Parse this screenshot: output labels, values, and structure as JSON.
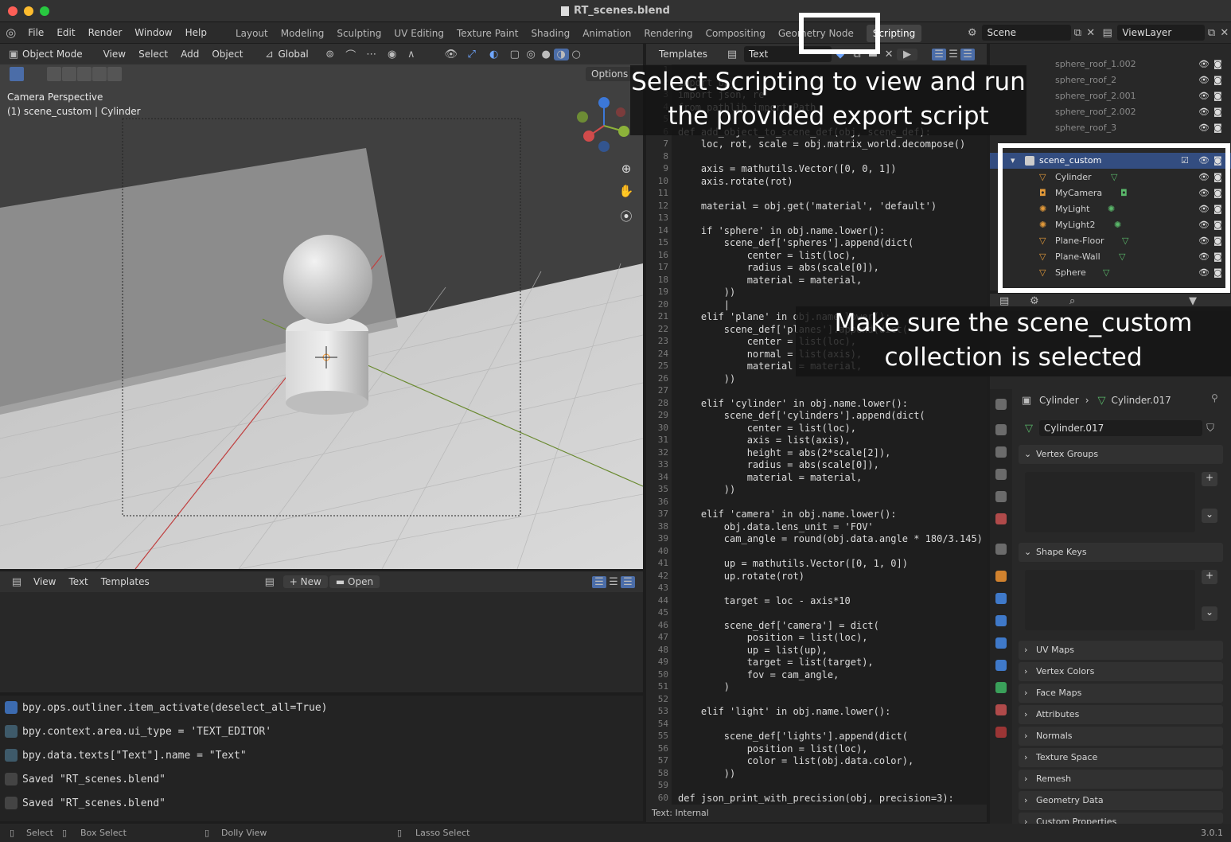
{
  "window": {
    "title": "RT_scenes.blend"
  },
  "menu": [
    "File",
    "Edit",
    "Render",
    "Window",
    "Help"
  ],
  "workspaces": [
    "Layout",
    "Modeling",
    "Sculpting",
    "UV Editing",
    "Texture Paint",
    "Shading",
    "Animation",
    "Rendering",
    "Compositing",
    "Geometry Node",
    "Scripting"
  ],
  "scene_field": "Scene",
  "viewlayer_field": "ViewLayer",
  "viewport": {
    "mode": "Object Mode",
    "menus": [
      "View",
      "Select",
      "Add",
      "Object"
    ],
    "transform": "Global",
    "options": "Options",
    "camera_label": "Camera Perspective",
    "object_label": "(1) scene_custom | Cylinder"
  },
  "text_editor": {
    "header_templates": "Templates",
    "text_name": "Text",
    "status": "Text: Internal",
    "lines": [
      {
        "n": "1",
        "t": ""
      },
      {
        "n": "2",
        "t": "import bpy"
      },
      {
        "n": "3",
        "t": "import json, re"
      },
      {
        "n": "4",
        "t": "from pathlib import Path"
      },
      {
        "n": "5",
        "t": ""
      },
      {
        "n": "6",
        "t": "def add_object_to_scene_def(obj, scene_def):"
      },
      {
        "n": "7",
        "t": "    loc, rot, scale = obj.matrix_world.decompose()"
      },
      {
        "n": "8",
        "t": ""
      },
      {
        "n": "9",
        "t": "    axis = mathutils.Vector([0, 0, 1])"
      },
      {
        "n": "10",
        "t": "    axis.rotate(rot)"
      },
      {
        "n": "11",
        "t": ""
      },
      {
        "n": "12",
        "t": "    material = obj.get('material', 'default')"
      },
      {
        "n": "13",
        "t": ""
      },
      {
        "n": "14",
        "t": "    if 'sphere' in obj.name.lower():"
      },
      {
        "n": "15",
        "t": "        scene_def['spheres'].append(dict("
      },
      {
        "n": "16",
        "t": "            center = list(loc),"
      },
      {
        "n": "17",
        "t": "            radius = abs(scale[0]),"
      },
      {
        "n": "18",
        "t": "            material = material,"
      },
      {
        "n": "19",
        "t": "        ))"
      },
      {
        "n": "20",
        "t": "        |"
      },
      {
        "n": "21",
        "t": "    elif 'plane' in obj.name.lower():"
      },
      {
        "n": "22",
        "t": "        scene_def['planes'].append(dict("
      },
      {
        "n": "23",
        "t": "            center = list(loc),"
      },
      {
        "n": "24",
        "t": "            normal = list(axis),"
      },
      {
        "n": "25",
        "t": "            material = material,"
      },
      {
        "n": "26",
        "t": "        ))"
      },
      {
        "n": "27",
        "t": ""
      },
      {
        "n": "28",
        "t": "    elif 'cylinder' in obj.name.lower():"
      },
      {
        "n": "29",
        "t": "        scene_def['cylinders'].append(dict("
      },
      {
        "n": "30",
        "t": "            center = list(loc),"
      },
      {
        "n": "31",
        "t": "            axis = list(axis),"
      },
      {
        "n": "32",
        "t": "            height = abs(2*scale[2]),"
      },
      {
        "n": "33",
        "t": "            radius = abs(scale[0]),"
      },
      {
        "n": "34",
        "t": "            material = material,"
      },
      {
        "n": "35",
        "t": "        ))"
      },
      {
        "n": "36",
        "t": ""
      },
      {
        "n": "37",
        "t": "    elif 'camera' in obj.name.lower():"
      },
      {
        "n": "38",
        "t": "        obj.data.lens_unit = 'FOV'"
      },
      {
        "n": "39",
        "t": "        cam_angle = round(obj.data.angle * 180/3.145)"
      },
      {
        "n": "40",
        "t": ""
      },
      {
        "n": "41",
        "t": "        up = mathutils.Vector([0, 1, 0])"
      },
      {
        "n": "42",
        "t": "        up.rotate(rot)"
      },
      {
        "n": "43",
        "t": ""
      },
      {
        "n": "44",
        "t": "        target = loc - axis*10"
      },
      {
        "n": "45",
        "t": ""
      },
      {
        "n": "46",
        "t": "        scene_def['camera'] = dict("
      },
      {
        "n": "47",
        "t": "            position = list(loc),"
      },
      {
        "n": "48",
        "t": "            up = list(up),"
      },
      {
        "n": "49",
        "t": "            target = list(target),"
      },
      {
        "n": "50",
        "t": "            fov = cam_angle,"
      },
      {
        "n": "51",
        "t": "        )"
      },
      {
        "n": "52",
        "t": ""
      },
      {
        "n": "53",
        "t": "    elif 'light' in obj.name.lower():"
      },
      {
        "n": "54",
        "t": ""
      },
      {
        "n": "55",
        "t": "        scene_def['lights'].append(dict("
      },
      {
        "n": "56",
        "t": "            position = list(loc),"
      },
      {
        "n": "57",
        "t": "            color = list(obj.data.color),"
      },
      {
        "n": "58",
        "t": "        ))"
      },
      {
        "n": "59",
        "t": ""
      },
      {
        "n": "60",
        "t": "def json_print_with_precision(obj, precision=3):"
      }
    ]
  },
  "outliner": {
    "top_items": [
      "sphere_roof_1.002",
      "sphere_roof_2",
      "sphere_roof_2.001",
      "sphere_roof_2.002",
      "sphere_roof_3"
    ],
    "collection": "scene_custom",
    "items": [
      "Cylinder",
      "MyCamera",
      "MyLight",
      "MyLight2",
      "Plane-Floor",
      "Plane-Wall",
      "Sphere"
    ]
  },
  "lower_editor": {
    "menus": [
      "View",
      "Text",
      "Templates"
    ],
    "new": "New",
    "open": "Open"
  },
  "info_log": [
    "bpy.ops.outliner.item_activate(deselect_all=True)",
    "bpy.context.area.ui_type = 'TEXT_EDITOR'",
    "bpy.data.texts[\"Text\"].name = \"Text\"",
    "Saved \"RT_scenes.blend\"",
    "Saved \"RT_scenes.blend\""
  ],
  "properties": {
    "breadcrumb_object": "Cylinder",
    "breadcrumb_mesh": "Cylinder.017",
    "mesh_field": "Cylinder.017",
    "sections": [
      "Vertex Groups",
      "Shape Keys",
      "UV Maps",
      "Vertex Colors",
      "Face Maps",
      "Attributes",
      "Normals",
      "Texture Space",
      "Remesh",
      "Geometry Data",
      "Custom Properties"
    ]
  },
  "statusbar": {
    "select": "Select",
    "box_select": "Box Select",
    "dolly": "Dolly View",
    "lasso": "Lasso Select",
    "version": "3.0.1"
  },
  "annotations": {
    "scripting": "Select Scripting to view and run the provided export script",
    "collection": "Make sure the scene_custom collection is selected"
  }
}
